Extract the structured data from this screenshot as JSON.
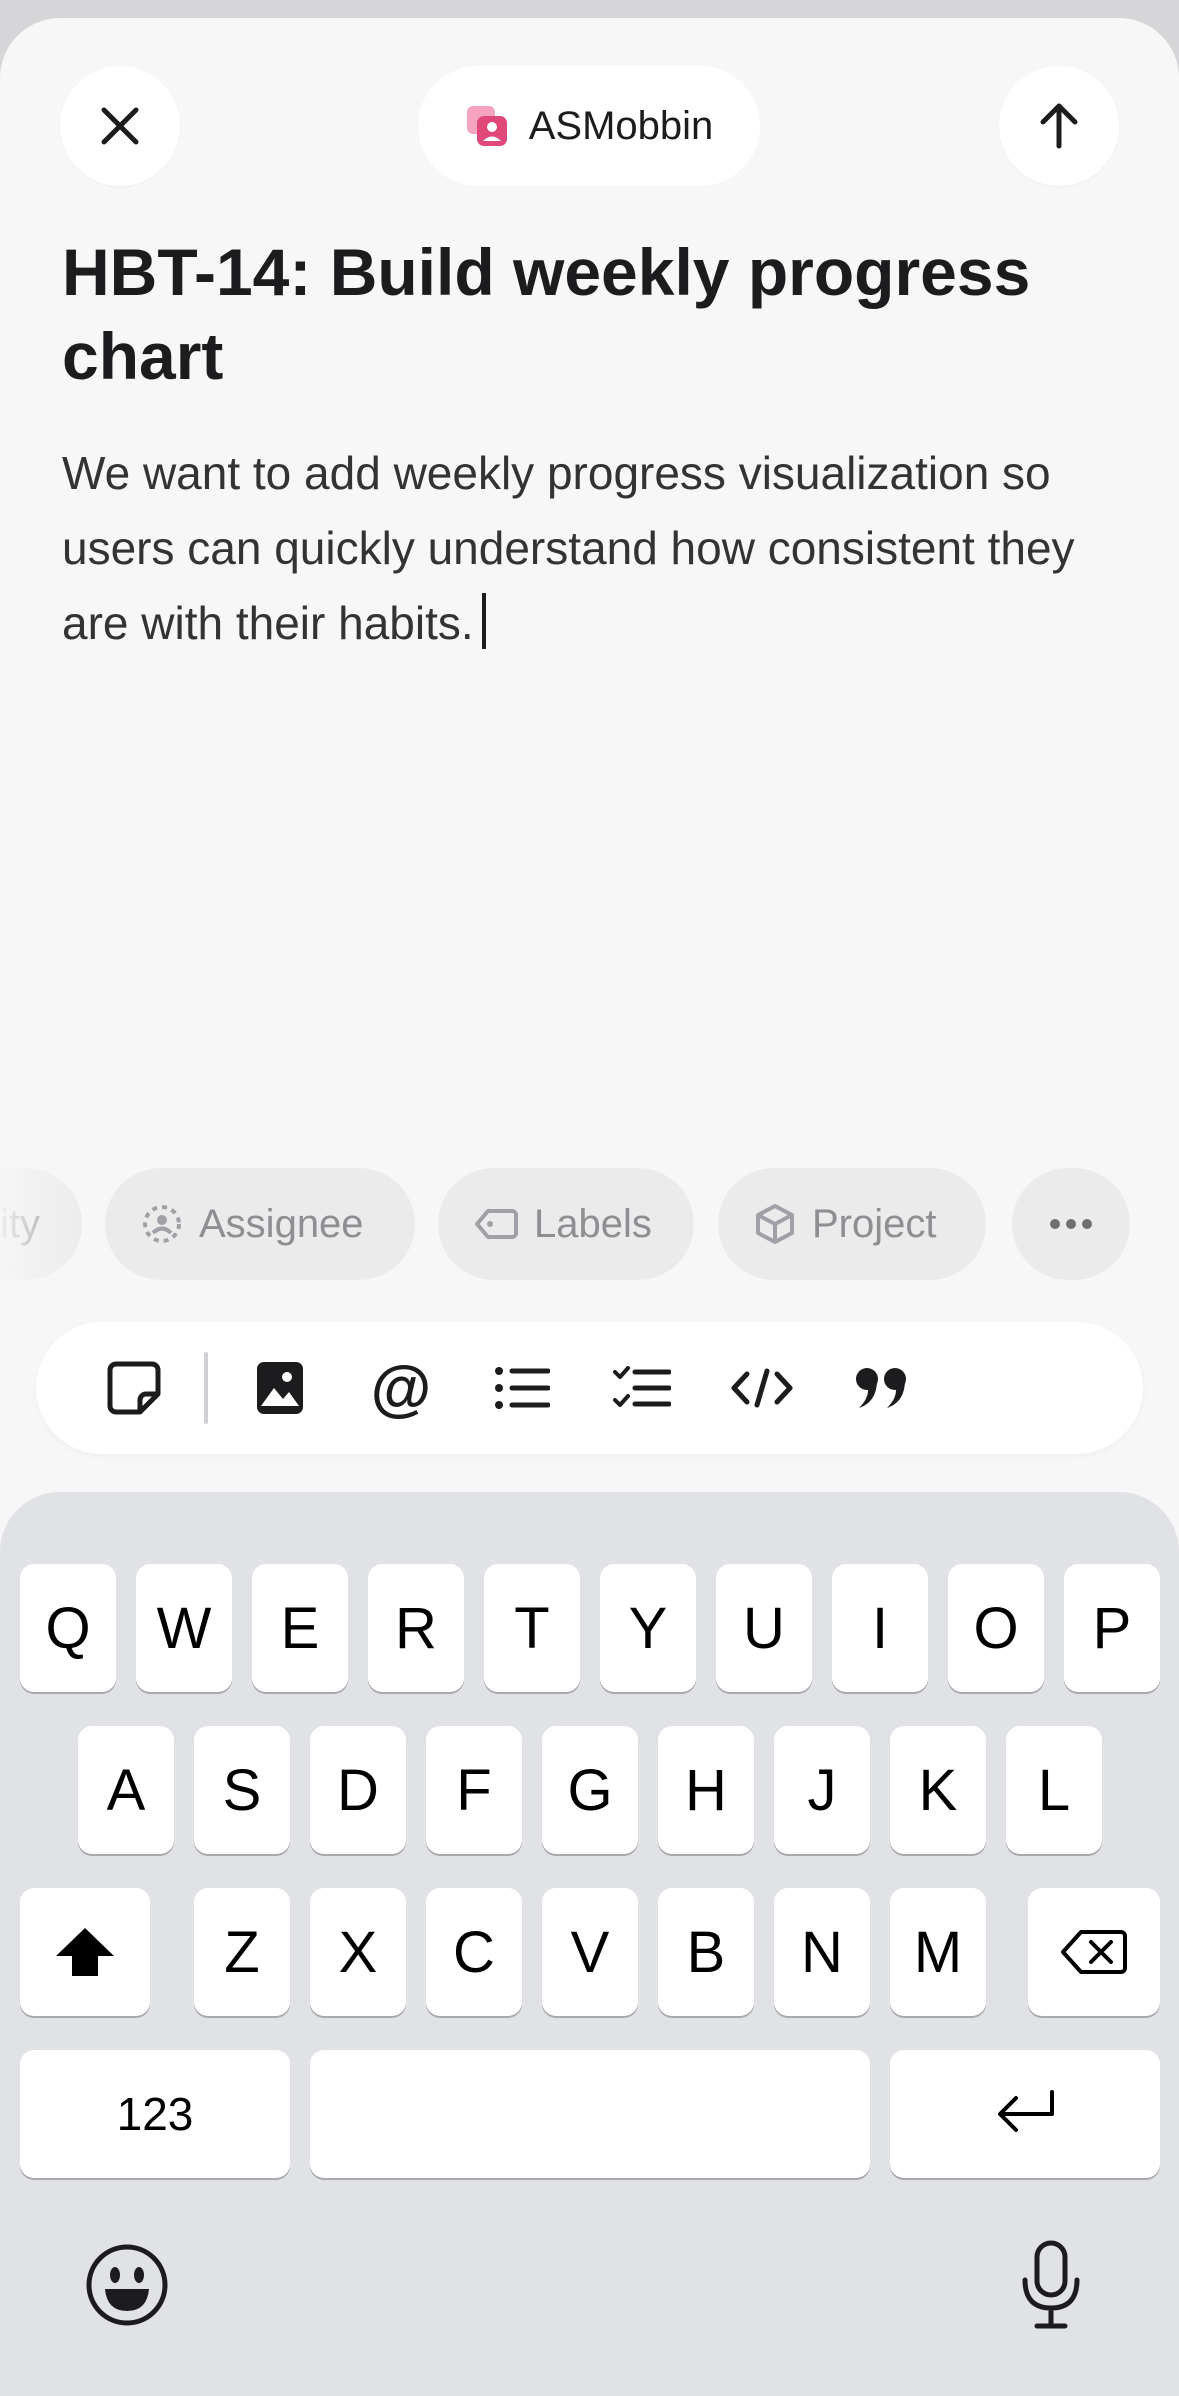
{
  "header": {
    "close_icon": "close-icon",
    "team_name": "ASMobbin",
    "team_icon": "team-icon",
    "team_color": "#e0487a",
    "send_icon": "arrow-up-icon"
  },
  "issue": {
    "title": "HBT-14: Build weekly progress chart",
    "description": "We want to add weekly progress visualization so users can quickly understand how consistent they are with their habits."
  },
  "properties": {
    "priority_partial": "ity",
    "assignee": "Assignee",
    "labels": "Labels",
    "project": "Project",
    "more_icon": "more-icon"
  },
  "formatting": {
    "icons": [
      "sticky-note-icon",
      "image-icon",
      "mention-icon",
      "bullet-list-icon",
      "checklist-icon",
      "code-icon",
      "quote-icon"
    ],
    "mention_glyph": "@"
  },
  "keyboard": {
    "row1": [
      "Q",
      "W",
      "E",
      "R",
      "T",
      "Y",
      "U",
      "I",
      "O",
      "P"
    ],
    "row2": [
      "A",
      "S",
      "D",
      "F",
      "G",
      "H",
      "J",
      "K",
      "L"
    ],
    "row3": [
      "Z",
      "X",
      "C",
      "V",
      "B",
      "N",
      "M"
    ],
    "numbers_key": "123",
    "shift_icon": "shift-icon",
    "backspace_icon": "backspace-icon",
    "return_icon": "return-icon",
    "emoji_icon": "emoji-icon",
    "mic_icon": "microphone-icon"
  }
}
